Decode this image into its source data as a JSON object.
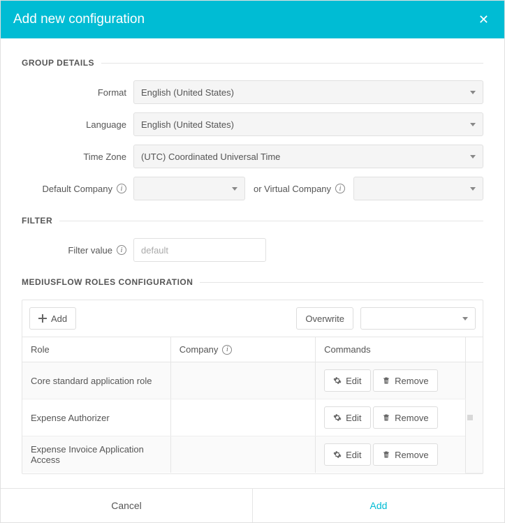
{
  "header": {
    "title": "Add new configuration"
  },
  "sections": {
    "group_details": "GROUP DETAILS",
    "filter": "FILTER",
    "roles": "MEDIUSFLOW ROLES CONFIGURATION"
  },
  "labels": {
    "format": "Format",
    "language": "Language",
    "timezone": "Time Zone",
    "default_company": "Default Company",
    "or_virtual_company": "or Virtual Company",
    "filter_value": "Filter value"
  },
  "values": {
    "format": "English (United States)",
    "language": "English (United States)",
    "timezone": "(UTC) Coordinated Universal Time",
    "default_company": "",
    "virtual_company": "",
    "filter_placeholder": "default",
    "overwrite_value": ""
  },
  "roles_toolbar": {
    "add": "Add",
    "overwrite": "Overwrite"
  },
  "roles_table": {
    "columns": {
      "role": "Role",
      "company": "Company",
      "commands": "Commands"
    },
    "buttons": {
      "edit": "Edit",
      "remove": "Remove"
    },
    "rows": [
      {
        "role": "Core standard application role",
        "company": ""
      },
      {
        "role": "Expense Authorizer",
        "company": ""
      },
      {
        "role": "Expense Invoice Application Access",
        "company": ""
      }
    ]
  },
  "footer": {
    "cancel": "Cancel",
    "add": "Add"
  }
}
